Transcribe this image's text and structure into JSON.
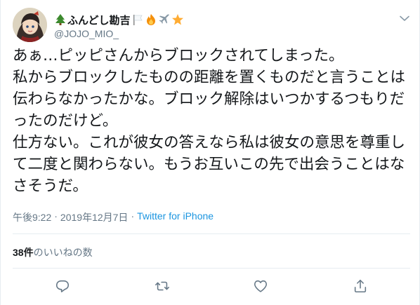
{
  "user": {
    "display_name": "ふんどし勘吉",
    "handle": "@JOJO_MIO_",
    "name_emojis": [
      "tree-emoji",
      "white-flag-emoji",
      "fire-emoji",
      "airplane-emoji",
      "star-emoji"
    ]
  },
  "tweet": {
    "text": "あぁ…ピッピさんからブロックされてしまった。\n私からブロックしたものの距離を置くものだと言うことは伝わらなかったかな。ブロック解除はいつかするつもりだったのだけど。\n仕方ない。これが彼女の答えなら私は彼女の意思を尊重して二度と関わらない。もうお互いこの先で出会うことはなさそうだ。",
    "time": "午後9:22",
    "separator": "·",
    "date": "2019年12月7日",
    "source": "Twitter for iPhone"
  },
  "stats": {
    "likes_count": "38件",
    "likes_label": "のいいねの数"
  },
  "actions": [
    "reply-icon",
    "retweet-icon",
    "like-icon",
    "share-icon"
  ],
  "colors": {
    "text": "#14171a",
    "secondary": "#657786",
    "link": "#1b95e0",
    "border": "#e6ecf0"
  }
}
